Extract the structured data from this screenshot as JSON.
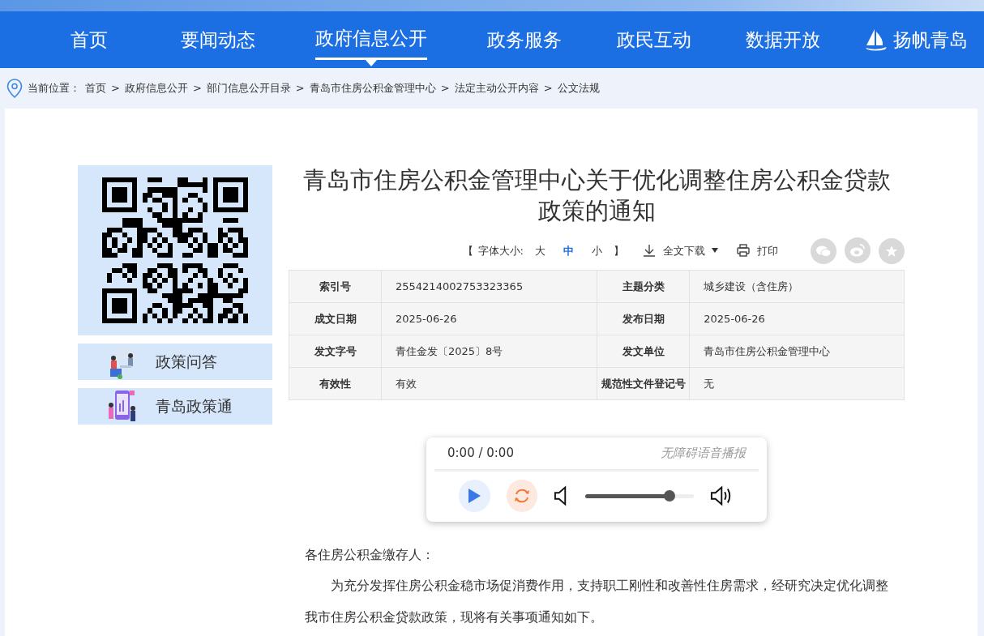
{
  "nav": [
    {
      "label": "首页",
      "selected": false
    },
    {
      "label": "要闻动态",
      "selected": false
    },
    {
      "label": "政府信息公开",
      "selected": true
    },
    {
      "label": "政务服务",
      "selected": false
    },
    {
      "label": "政民互动",
      "selected": false
    },
    {
      "label": "数据开放",
      "selected": false
    }
  ],
  "brand": "扬帆青岛",
  "breadcrumb": {
    "label": "当前位置：",
    "separator": ">",
    "items": [
      "首页",
      "政府信息公开",
      "部门信息公开目录",
      "青岛市住房公积金管理中心",
      "法定主动公开内容",
      "公文法规"
    ]
  },
  "sidebar": {
    "links": [
      "政策问答",
      "青岛政策通"
    ]
  },
  "article": {
    "title": "青岛市住房公积金管理中心关于优化调整住房公积金贷款政策的通知",
    "font_size": {
      "open": "【",
      "label": "字体大小:",
      "options": [
        {
          "label": "大",
          "selected": false
        },
        {
          "label": "中",
          "selected": true
        },
        {
          "label": "小",
          "selected": false
        }
      ],
      "close": "】"
    },
    "download": "全文下载",
    "print": "打印",
    "meta": [
      [
        "索引号",
        "2554214002753323365",
        "主题分类",
        "城乡建设（含住房）"
      ],
      [
        "成文日期",
        "2025-06-26",
        "发布日期",
        "2025-06-26"
      ],
      [
        "发文字号",
        "青住金发〔2025〕8号",
        "发文单位",
        "青岛市住房公积金管理中心"
      ],
      [
        "有效性",
        "有效",
        "规范性文件登记号",
        "无"
      ]
    ],
    "player": {
      "time": "0:00 / 0:00",
      "caption": "无障碍语音播报",
      "volume": {
        "level": 0.78
      }
    },
    "greeting": "各住房公积金缴存人：",
    "paragraphs": [
      "为充分发挥住房公积金稳市场促消费作用，支持职工刚性和改善性住房需求，经研究决定优化调整我市住房公积金贷款政策，现将有关事项通知如下。"
    ]
  }
}
